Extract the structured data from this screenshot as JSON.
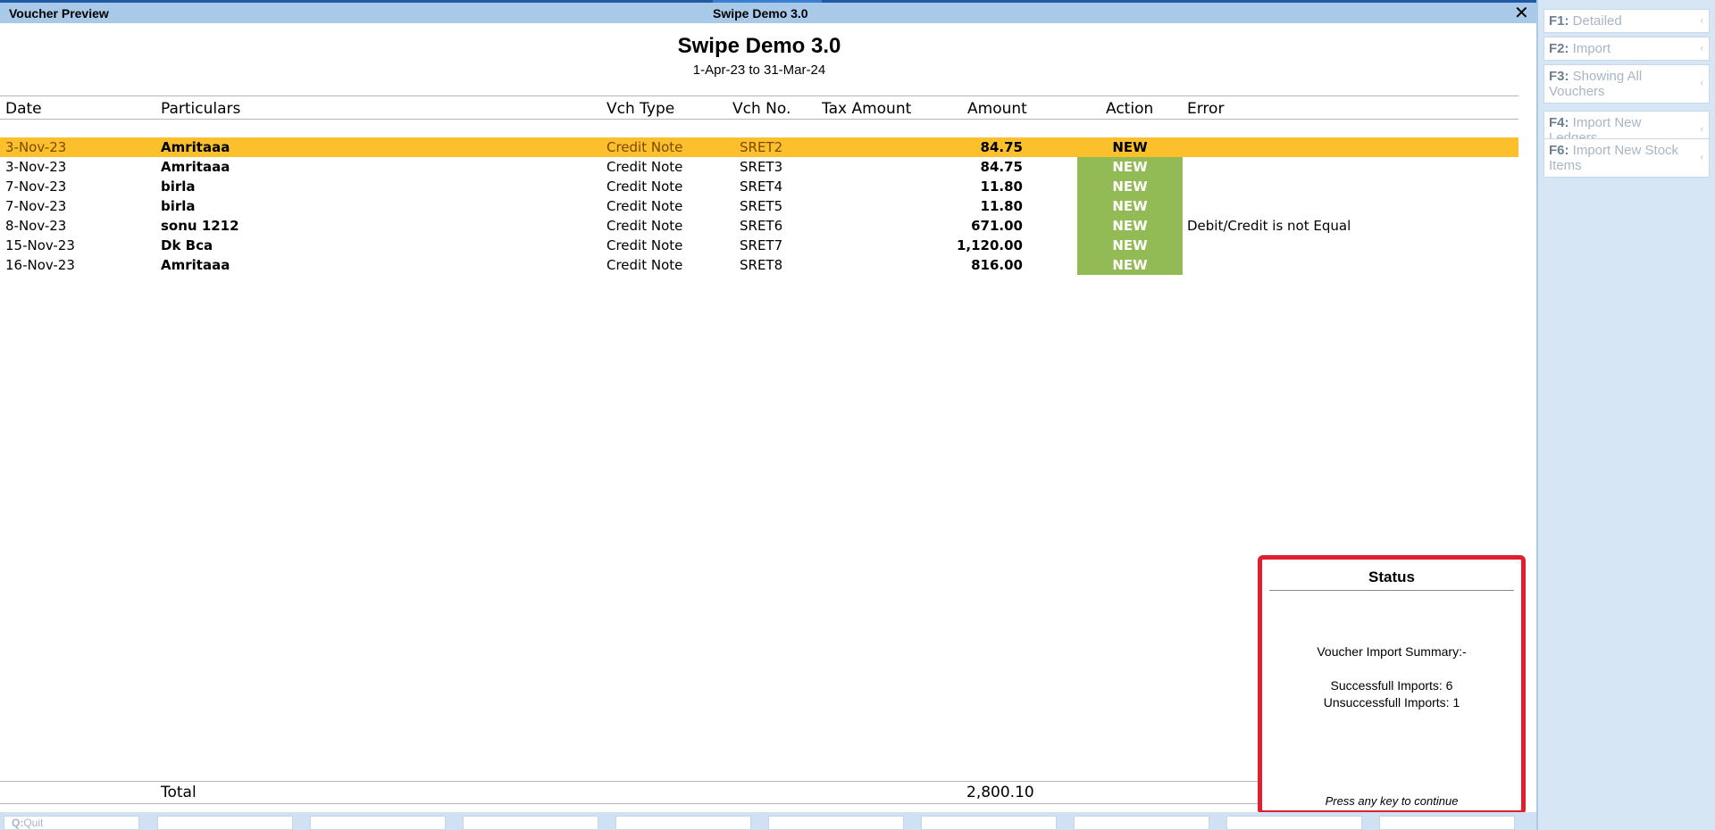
{
  "window": {
    "left_title": "Voucher Preview",
    "center_title": "Swipe Demo 3.0",
    "close_glyph": "✕"
  },
  "report": {
    "company": "Swipe Demo 3.0",
    "period": "1-Apr-23 to 31-Mar-24"
  },
  "columns": {
    "date": "Date",
    "particulars": "Particulars",
    "vch_type": "Vch Type",
    "vch_no": "Vch No.",
    "tax_amount": "Tax Amount",
    "amount": "Amount",
    "action": "Action",
    "error": "Error"
  },
  "rows": [
    {
      "date": "3-Nov-23",
      "particulars": "Amritaaa",
      "vch_type": "Credit Note",
      "vch_no": "SRET2",
      "amount": "84.75",
      "action": "NEW",
      "error": ""
    },
    {
      "date": "3-Nov-23",
      "particulars": "Amritaaa",
      "vch_type": "Credit Note",
      "vch_no": "SRET3",
      "amount": "84.75",
      "action": "NEW",
      "error": ""
    },
    {
      "date": "7-Nov-23",
      "particulars": "birla",
      "vch_type": "Credit Note",
      "vch_no": "SRET4",
      "amount": "11.80",
      "action": "NEW",
      "error": ""
    },
    {
      "date": "7-Nov-23",
      "particulars": "birla",
      "vch_type": "Credit Note",
      "vch_no": "SRET5",
      "amount": "11.80",
      "action": "NEW",
      "error": ""
    },
    {
      "date": "8-Nov-23",
      "particulars": "sonu 1212",
      "vch_type": "Credit Note",
      "vch_no": "SRET6",
      "amount": "671.00",
      "action": "NEW",
      "error": "Debit/Credit is not Equal"
    },
    {
      "date": "15-Nov-23",
      "particulars": "Dk Bca",
      "vch_type": "Credit Note",
      "vch_no": "SRET7",
      "amount": "1,120.00",
      "action": "NEW",
      "error": ""
    },
    {
      "date": "16-Nov-23",
      "particulars": "Amritaaa",
      "vch_type": "Credit Note",
      "vch_no": "SRET8",
      "amount": "816.00",
      "action": "NEW",
      "error": ""
    }
  ],
  "total": {
    "label": "Total",
    "amount": "2,800.10"
  },
  "status": {
    "title": "Status",
    "summary": "Voucher Import Summary:-",
    "success": "Successfull Imports: 6",
    "fail": "Unsuccessfull Imports: 1",
    "continue": "Press any key to continue"
  },
  "bottom_bar": {
    "quit_key": "Q:",
    "quit_label": "Quit"
  },
  "sidebar": [
    {
      "key": "F1:",
      "label": "Detailed"
    },
    {
      "key": "F2:",
      "label": "Import"
    },
    {
      "key": "F3:",
      "label": "Showing All Vouchers"
    },
    {
      "key": "F4:",
      "label": "Import New Ledgers"
    },
    {
      "key": "F6:",
      "label": "Import New Stock Items"
    }
  ],
  "colors": {
    "selected_row": "#fcc02c",
    "action_new": "#93bb55",
    "dialog_border": "#e0202e",
    "titlebar": "#a9c9e9"
  }
}
